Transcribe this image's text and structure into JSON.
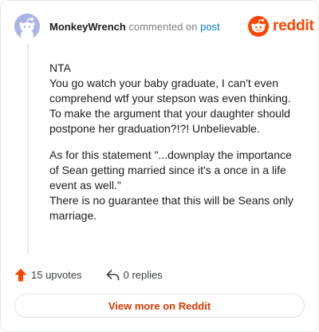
{
  "comment": {
    "username": "MonkeyWrench",
    "action_text": "commented on",
    "post_link": "post",
    "paragraphs": [
      [
        "NTA",
        "You go watch your baby graduate, I can't even comprehend wtf your stepson was even thinking. To make the argument that your daughter should postpone her graduation?!?! Unbelievable."
      ],
      [
        "As for this statement \"...downplay the importance of Sean getting married since it's a once in a life event as well.\"",
        "There is no guarantee that this will be Seans only marriage."
      ]
    ]
  },
  "brand": {
    "wordmark": "reddit",
    "color": "#ff4500"
  },
  "stats": {
    "upvotes_label": "15 upvotes",
    "replies_label": "0 replies"
  },
  "actions": {
    "view_more_label": "View more on Reddit"
  },
  "icons": {
    "upvote": "upvote-arrow-icon",
    "reply": "reply-arrow-icon",
    "logo": "reddit-snoo-icon",
    "avatar": "default-snoo-avatar"
  }
}
